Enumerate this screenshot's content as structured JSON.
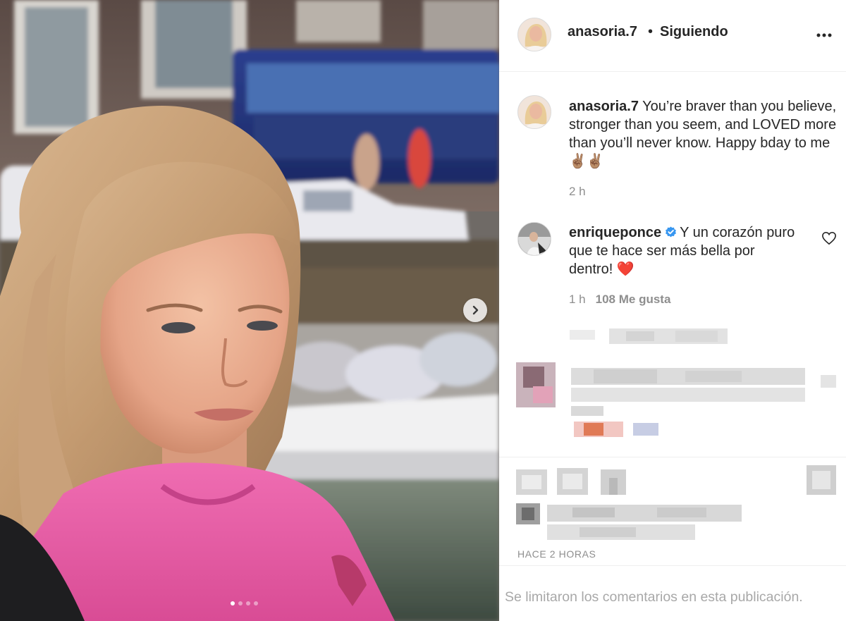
{
  "post": {
    "username": "anasoria.7",
    "separator": "•",
    "follow_status": "Siguiendo",
    "more_icon": "more-options-icon"
  },
  "caption": {
    "username": "anasoria.7",
    "text": " You’re braver than you believe, stronger than you seem, and LOVED more than you’ll never know. Happy bday to me ✌🏽✌🏽",
    "time": "2 h"
  },
  "comment": {
    "username": "enriqueponce",
    "text": "Y un corazón puro que te hace ser más bella por dentro! ❤️",
    "time": "1 h",
    "likes": "108 Me gusta",
    "verified_color": "#3897f0"
  },
  "footer": {
    "timestamp": "HACE 2 HORAS",
    "comments_limited": "Se limitaron los comentarios en esta publicación."
  },
  "carousel": {
    "slides": 4,
    "active_slide": 1
  },
  "colors": {
    "secondary_text": "#8e8e8e",
    "border": "#efefef",
    "shirt": "#e85aa3"
  }
}
